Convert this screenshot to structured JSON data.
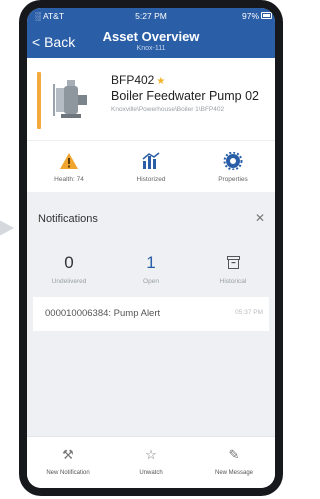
{
  "status_bar": {
    "carrier": "AT&T",
    "time": "5:27 PM",
    "battery": "97%"
  },
  "nav": {
    "back_label": "< Back",
    "title": "Asset Overview",
    "subtitle": "Knox-111"
  },
  "asset": {
    "id": "BFP402",
    "starred": true,
    "name": "Boiler Feedwater Pump 02",
    "path": "Knoxville\\Powerhouse\\Boiler 1\\BFP402",
    "accent_color": "#f3a93c"
  },
  "tiles": [
    {
      "label": "Health: 74",
      "icon": "warning-triangle-icon",
      "color": "#f0a52e"
    },
    {
      "label": "Historized",
      "icon": "bar-chart-icon",
      "color": "#2a5ea7"
    },
    {
      "label": "Properties",
      "icon": "gear-icon",
      "color": "#2a5ea7"
    }
  ],
  "notifications": {
    "title": "Notifications",
    "close_icon": "close-icon",
    "counters": [
      {
        "value": "0",
        "label": "Undelivered"
      },
      {
        "value": "1",
        "label": "Open"
      },
      {
        "value": "",
        "label": "Historical",
        "icon": "archive-box-icon"
      }
    ],
    "items": [
      {
        "text": "000010006384: Pump Alert",
        "time": "05:37 PM"
      }
    ]
  },
  "toolbar": [
    {
      "label": "New Notification",
      "icon": "tools-icon"
    },
    {
      "label": "Unwatch",
      "icon": "star-outline-icon"
    },
    {
      "label": "New Message",
      "icon": "compose-icon"
    }
  ],
  "colors": {
    "header": "#2a5ea7",
    "accent": "#f3a93c",
    "panel": "#eef0f3"
  }
}
